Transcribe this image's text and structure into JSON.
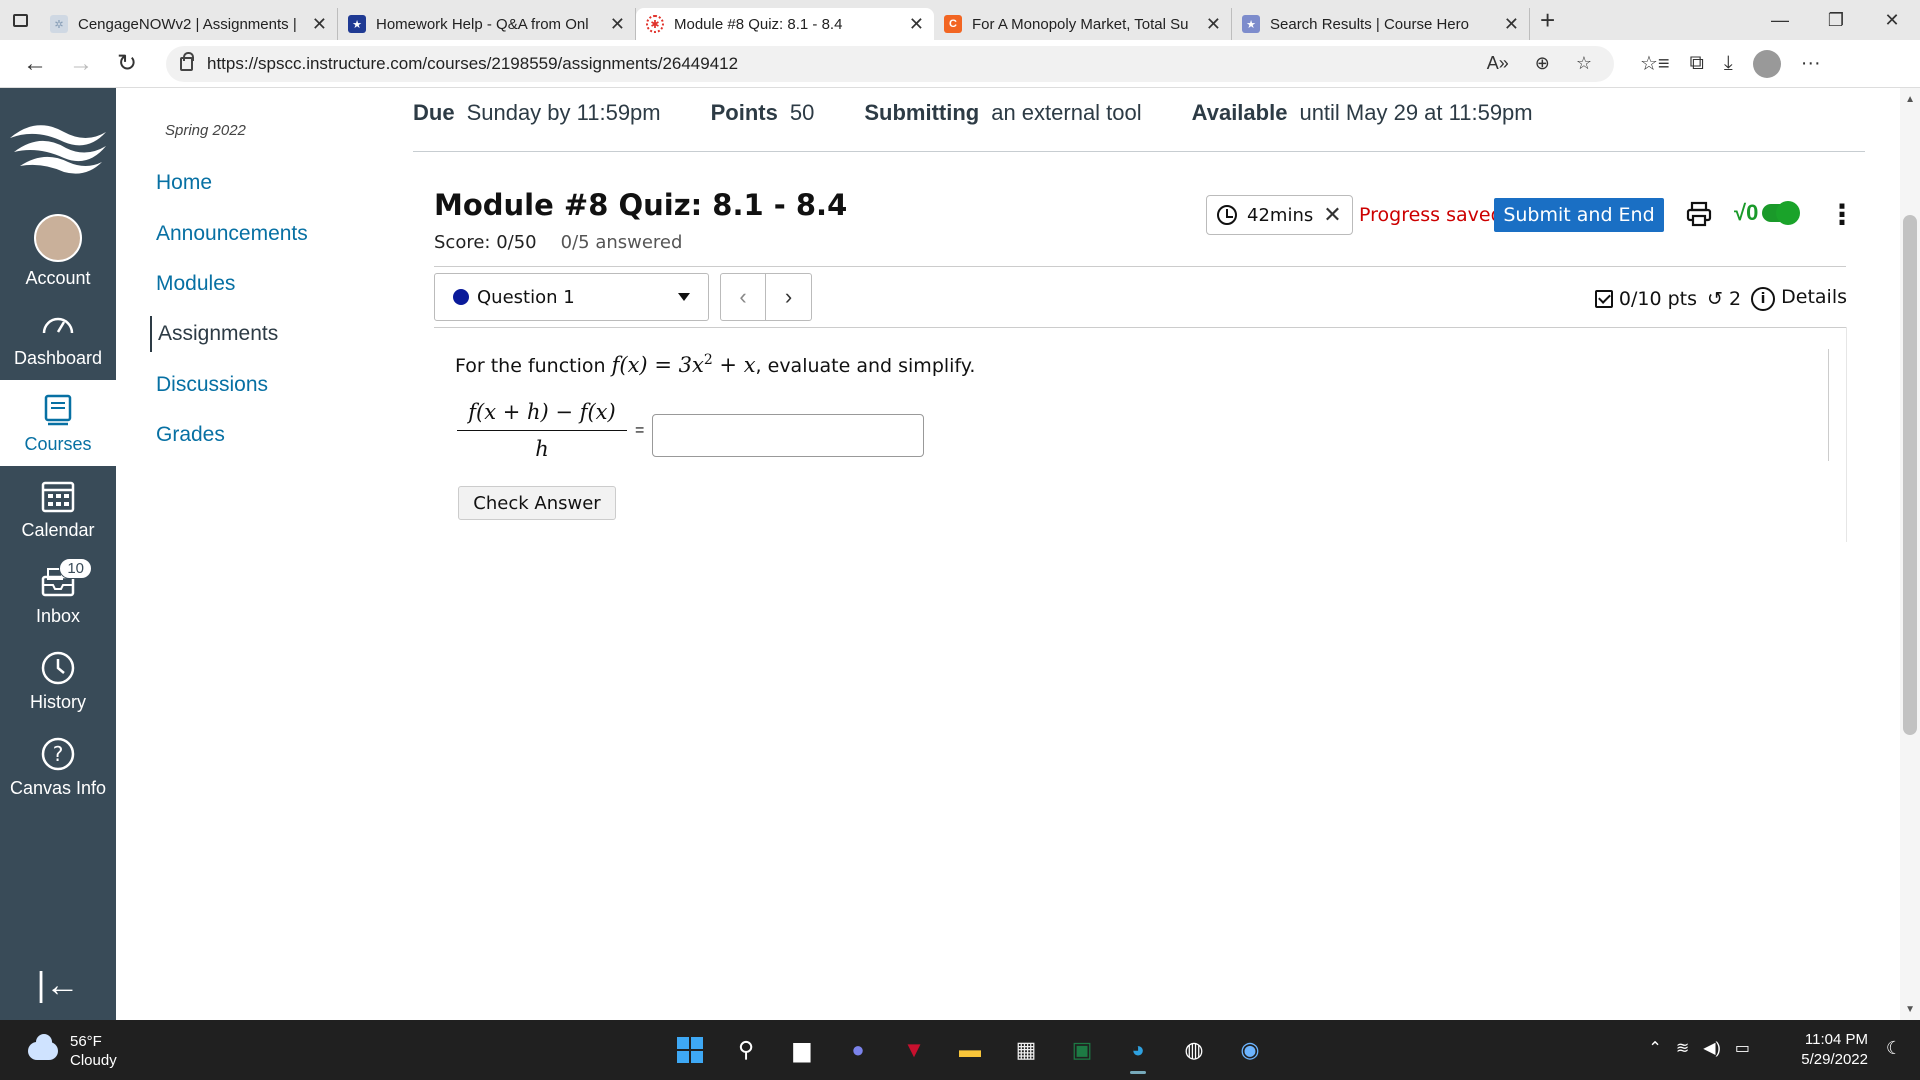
{
  "browser": {
    "tabs": [
      {
        "label": "CengageNOWv2 | Assignments |",
        "favicon_color": "#8aa0b8",
        "active": false
      },
      {
        "label": "Homework Help - Q&A from Onl",
        "favicon_color": "#1f3a93",
        "active": false
      },
      {
        "label": "Module #8 Quiz: 8.1 - 8.4",
        "favicon_color": "#e0322b",
        "active": true
      },
      {
        "label": "For A Monopoly Market, Total Su",
        "favicon_color": "#f26522",
        "favicon_letter": "C",
        "active": false
      },
      {
        "label": "Search Results | Course Hero",
        "favicon_color": "#7d8ccc",
        "active": false
      }
    ],
    "new_tab": "+",
    "url": "https://spscc.instructure.com/courses/2198559/assignments/26449412"
  },
  "global_nav": {
    "items": [
      {
        "label": "Account",
        "icon": "avatar"
      },
      {
        "label": "Dashboard",
        "icon": "dashboard-icon"
      },
      {
        "label": "Courses",
        "icon": "courses-icon",
        "active": true
      },
      {
        "label": "Calendar",
        "icon": "calendar-icon"
      },
      {
        "label": "Inbox",
        "icon": "inbox-icon",
        "badge": "10"
      },
      {
        "label": "History",
        "icon": "history-icon"
      },
      {
        "label": "Canvas Info",
        "icon": "help-icon"
      }
    ],
    "collapse": "|←"
  },
  "course_nav": {
    "term": "Spring 2022",
    "items": [
      {
        "label": "Home"
      },
      {
        "label": "Announcements"
      },
      {
        "label": "Modules"
      },
      {
        "label": "Assignments",
        "active": true
      },
      {
        "label": "Discussions"
      },
      {
        "label": "Grades"
      }
    ]
  },
  "assignment": {
    "due_label": "Due",
    "due_value": "Sunday by 11:59pm",
    "points_label": "Points",
    "points_value": "50",
    "submitting_label": "Submitting",
    "submitting_value": "an external tool",
    "available_label": "Available",
    "available_value": "until May 29 at 11:59pm"
  },
  "quiz": {
    "title": "Module #8 Quiz: 8.1 - 8.4",
    "score": "Score: 0/50",
    "answered": "0/5 answered",
    "timer": "42mins",
    "progress": "Progress saved",
    "submit_label": "Submit and End",
    "question_label": "Question 1",
    "pts": "0/10 pts",
    "attempts": "2",
    "details": "Details",
    "question_prefix": "For the function",
    "question_suffix": ", evaluate and simplify.",
    "func_lhs": "f(x)",
    "func_rhs_a": "3x",
    "func_exp": "2",
    "func_rhs_b": "+ x",
    "frac_num": "f(x + h) − f(x)",
    "frac_den": "h",
    "equals": "=",
    "answer_value": "",
    "check_label": "Check Answer"
  },
  "taskbar": {
    "temp": "56°F",
    "condition": "Cloudy",
    "time": "11:04 PM",
    "date": "5/29/2022"
  }
}
